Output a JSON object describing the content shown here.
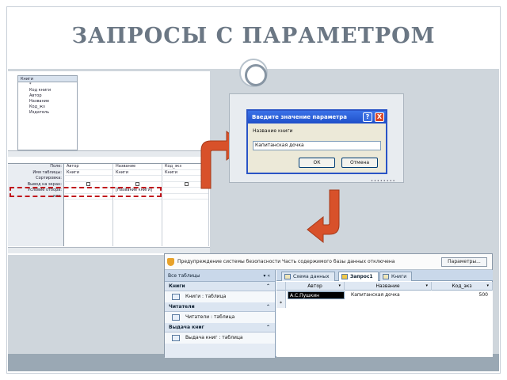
{
  "slide": {
    "title": "ЗАПРОСЫ С ПАРАМЕТРОМ"
  },
  "designer": {
    "table_fields": [
      "Книги",
      "*",
      "Код книги",
      "Автор",
      "Название",
      "Код_жз",
      "Издатель"
    ],
    "row_labels": [
      "Поле:",
      "Имя таблицы:",
      "Сортировка:",
      "Вывод на экран:",
      "Условие отбора:",
      "или:"
    ],
    "columns": [
      {
        "field": "Автор",
        "table": "Книги",
        "criteria": ""
      },
      {
        "field": "Название",
        "table": "Книги",
        "criteria": "[Название книги]"
      },
      {
        "field": "Код_экз",
        "table": "Книги",
        "criteria": ""
      }
    ]
  },
  "dialog": {
    "title": "Введите значение параметра",
    "help": "?",
    "close": "X",
    "label": "Название книги",
    "input_value": "Капитанская дочка",
    "ok": "ОК",
    "cancel": "Отмена"
  },
  "access": {
    "security_message": "Предупреждение системы безопасности   Часть содержимого базы данных отключена",
    "params_button": "Параметры...",
    "nav_header": "Все таблицы",
    "groups": [
      {
        "name": "Книги",
        "item": "Книги : таблица"
      },
      {
        "name": "Читатели",
        "item": "Читатели : таблица"
      },
      {
        "name": "Выдача книг",
        "item": "Выдача книг : таблица"
      }
    ],
    "tabs": [
      "Схема данных",
      "Запрос1",
      "Книги"
    ],
    "columns": [
      "Автор",
      "Название",
      "Код_экз"
    ],
    "row": {
      "author": "А.С.Пушкин",
      "title": "Капитанская дочка",
      "code": "500"
    },
    "new_row_marker": "*"
  },
  "colors": {
    "title": "#6b7784",
    "arrow": "#d8512a",
    "dashed": "#c0161c",
    "dialog_title": "#1f4fc8"
  }
}
